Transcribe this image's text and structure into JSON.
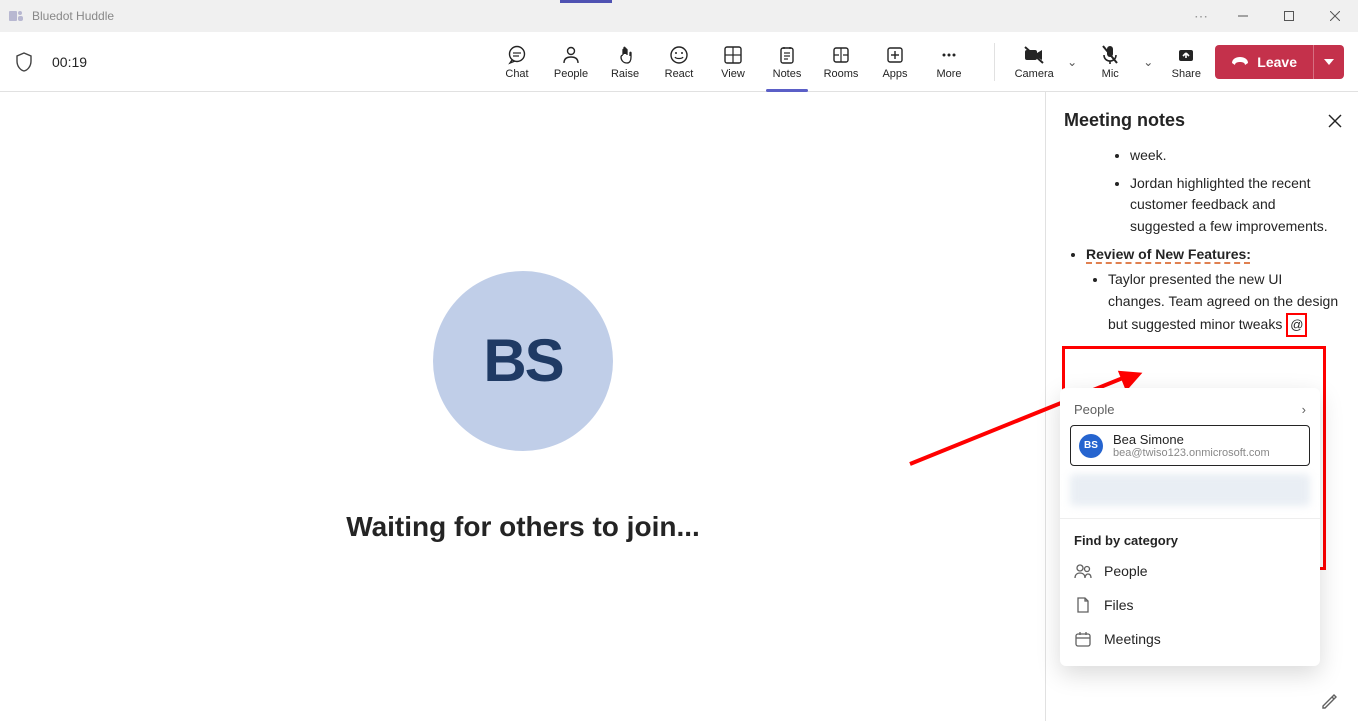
{
  "titlebar": {
    "app_name": "Bluedot Huddle"
  },
  "toolbar": {
    "timer": "00:19",
    "actions": {
      "chat": "Chat",
      "people": "People",
      "raise": "Raise",
      "react": "React",
      "view": "View",
      "notes": "Notes",
      "rooms": "Rooms",
      "apps": "Apps",
      "more": "More"
    },
    "controls": {
      "camera": "Camera",
      "mic": "Mic",
      "share": "Share"
    },
    "leave": "Leave"
  },
  "main": {
    "avatar_initials": "BS",
    "waiting": "Waiting for others to join..."
  },
  "panel": {
    "title": "Meeting notes",
    "note1_tail": "week.",
    "note2": "Jordan highlighted the recent customer feedback and suggested a few improvements.",
    "review_heading": "Review of New Features:",
    "note3_a": "Taylor presented the new UI changes. Team agreed on the design but suggested minor tweaks ",
    "note3_at": "@"
  },
  "mention": {
    "section": "People",
    "person_initials": "BS",
    "person_name": "Bea Simone",
    "person_email": "bea@twiso123.onmicrosoft.com",
    "find_by_category": "Find by category",
    "cat_people": "People",
    "cat_files": "Files",
    "cat_meetings": "Meetings"
  }
}
